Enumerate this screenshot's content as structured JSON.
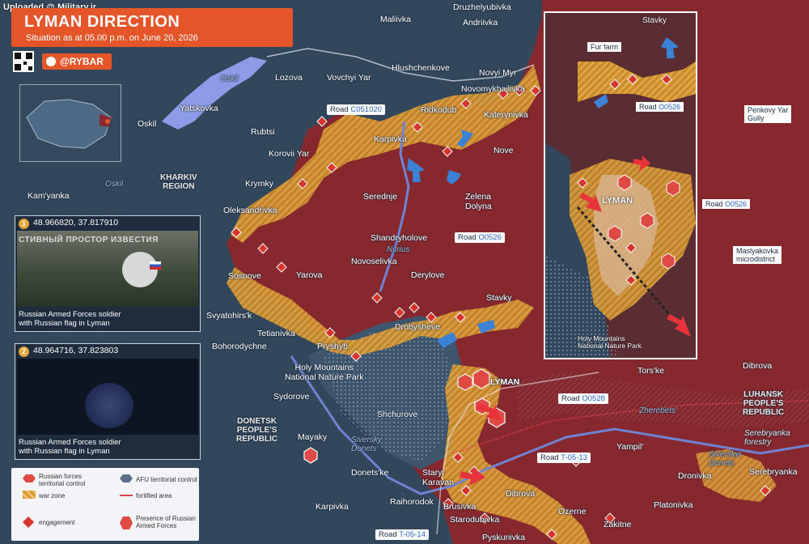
{
  "header": {
    "watermark": "Uploaded @ Military.ir",
    "title": "LYMAN DIRECTION",
    "subtitle": "Situation as at 05.00 p.m. on June 20, 2026",
    "handle": "@RYBAR"
  },
  "colors": {
    "russian_control": "#8a2b30",
    "war_zone": "#d99a2e",
    "afu_control": "#3a5168",
    "water": "#8f9fe6",
    "accent": "#e5552a"
  },
  "settlements": {
    "maliivka": "Maliivka",
    "druzhelyubivka": "Druzhelyubivka",
    "andriivka": "Andriivka",
    "lozova": "Lozova",
    "vovchyi_yar": "Vovchyi Yar",
    "hlushchenkove": "Hlushchenkove",
    "novyi_myr": "Novyi Myr",
    "novomykhailivka": "Novomykhailivka",
    "yatskovka": "Yatskovka",
    "oskil": "Oskil",
    "rubtsi": "Rubtsi",
    "ridkodub": "Ridkodub",
    "katerynivka": "Katerynivka",
    "korovii_yar": "Korovii Yar",
    "karpivka": "Karpivka",
    "nove": "Nove",
    "krymky": "Krymky",
    "kamyanka": "Kam'yanka",
    "seredne": "Serednje",
    "zelena_dolyna": "Zelena\nDolyna",
    "oleksandrivka": "Oleksandrivka",
    "shandryholove": "Shandryholove",
    "novoselivka": "Novoselivka",
    "derylove": "Derylove",
    "sosnove": "Sosnove",
    "yarova": "Yarova",
    "stavky": "Stavky",
    "svyatohirsk": "Svyatohirs'k",
    "tetianivka": "Tetianivka",
    "drobysheve": "Drobysheve",
    "bohorodychne": "Bohorodychne",
    "pryshyb": "Pryshyb",
    "lyman": "LYMAN",
    "torske": "Tors'ke",
    "dibrova_e": "Dibrova",
    "sydorove": "Sydorove",
    "shchurove": "Shchurove",
    "mayaky": "Mayaky",
    "yampil": "Yampil'",
    "donetske": "Donets'ke",
    "staryi_karavan": "Staryi\nKaravan",
    "dibrova_s": "Dibrova",
    "dronivka": "Dronivka",
    "serebryanka": "Serebryanka",
    "karpivka_s": "Karpivka",
    "raihorodok": "Raihorodok",
    "brusivka": "Brusivka",
    "starodubivka": "Starodubivka",
    "ozerne": "Ozerne",
    "platonivka": "Platonivka",
    "zakitne": "Zakitne",
    "pyskunivka": "Pyskunivka"
  },
  "regions": {
    "kharkiv": "KHARKIV\nREGION",
    "donetsk": "DONETSK\nPEOPLE'S\nREPUBLIC",
    "luhansk": "LUHANSK\nPEOPLE'S\nREPUBLIC",
    "holy_mountains": "Holy Mountains\nNational Nature Park"
  },
  "water": {
    "oskil_river": "Oskil",
    "oskil_res": "Oskil",
    "nitrius": "Nitrius",
    "siversky_donets": "Siversky\nDonets",
    "zherebets": "Zherebets'",
    "siversky_donets_e": "Siverskyi\nDonets",
    "serebryanka_forestry": "Serebryanka\nforestry"
  },
  "roads": [
    {
      "prefix": "Road ",
      "code": "C051020"
    },
    {
      "prefix": "Road ",
      "code": "O0526"
    },
    {
      "prefix": "Road ",
      "code": "O0528"
    },
    {
      "prefix": "Road ",
      "code": "T-05-13"
    },
    {
      "prefix": "Road ",
      "code": "T-05-14"
    }
  ],
  "panels": [
    {
      "num": "1",
      "coords": "48.966820, 37.817910",
      "caption": "Russian Armed Forces soldier\nwith Russian flag in Lyman",
      "overlay": "СТИВНЫЙ ПРОСТОР ИЗВЕСТИЯ"
    },
    {
      "num": "2",
      "coords": "48.964716, 37.823803",
      "caption": "Russian Armed Forces soldier\nwith Russian flag in Lyman"
    }
  ],
  "inset": {
    "stavky": "Stavky",
    "fur_farm": "Fur farm",
    "road_a": {
      "prefix": "Road ",
      "code": "O0526"
    },
    "road_b": {
      "prefix": "Road ",
      "code": "O0526"
    },
    "penkovy": "Penkovy Yar\nGully",
    "lyman": "LYMAN",
    "maslyakovka": "Maslyakovka\nmicrodistrict",
    "holy_mountains": "Holy Mountains\nNational Nature Park"
  },
  "legend": {
    "russian_control": "Russian forces\nterritorial control",
    "afu_control": "AFU territorial control",
    "war_zone": "war zone",
    "fortified": "fortified area",
    "engagement": "engagement",
    "presence": "Presence of Russian\nArmed Forces"
  }
}
